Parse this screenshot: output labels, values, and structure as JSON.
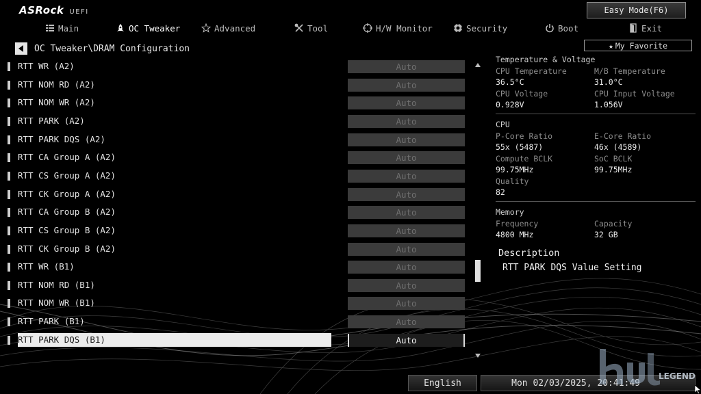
{
  "brand": {
    "logo": "ASRock",
    "suffix": "UEFI"
  },
  "easy_mode": {
    "label": "Easy Mode(F6)"
  },
  "nav": [
    {
      "id": "main",
      "label": "Main",
      "icon": "list-icon",
      "active": false
    },
    {
      "id": "oc-tweaker",
      "label": "OC Tweaker",
      "icon": "rocket-icon",
      "active": true
    },
    {
      "id": "advanced",
      "label": "Advanced",
      "icon": "star-icon",
      "active": false
    },
    {
      "id": "tool",
      "label": "Tool",
      "icon": "tools-icon",
      "active": false
    },
    {
      "id": "hw-monitor",
      "label": "H/W Monitor",
      "icon": "crosshair-icon",
      "active": false
    },
    {
      "id": "security",
      "label": "Security",
      "icon": "shield-icon",
      "active": false
    },
    {
      "id": "boot",
      "label": "Boot",
      "icon": "power-icon",
      "active": false
    },
    {
      "id": "exit",
      "label": "Exit",
      "icon": "exit-door-icon",
      "active": false
    }
  ],
  "breadcrumb": {
    "path": "OC Tweaker\\DRAM Configuration"
  },
  "favorite": {
    "label": "My Favorite"
  },
  "settings": [
    {
      "label": "RTT WR (A2)",
      "value": "Auto",
      "selected": false
    },
    {
      "label": "RTT NOM RD (A2)",
      "value": "Auto",
      "selected": false
    },
    {
      "label": "RTT NOM WR (A2)",
      "value": "Auto",
      "selected": false
    },
    {
      "label": "RTT PARK (A2)",
      "value": "Auto",
      "selected": false
    },
    {
      "label": "RTT PARK DQS (A2)",
      "value": "Auto",
      "selected": false
    },
    {
      "label": "RTT CA Group A (A2)",
      "value": "Auto",
      "selected": false
    },
    {
      "label": "RTT CS Group A (A2)",
      "value": "Auto",
      "selected": false
    },
    {
      "label": "RTT CK Group A (A2)",
      "value": "Auto",
      "selected": false
    },
    {
      "label": "RTT CA Group B (A2)",
      "value": "Auto",
      "selected": false
    },
    {
      "label": "RTT CS Group B (A2)",
      "value": "Auto",
      "selected": false
    },
    {
      "label": "RTT CK Group B (A2)",
      "value": "Auto",
      "selected": false
    },
    {
      "label": "RTT WR (B1)",
      "value": "Auto",
      "selected": false
    },
    {
      "label": "RTT NOM RD (B1)",
      "value": "Auto",
      "selected": false
    },
    {
      "label": "RTT NOM WR (B1)",
      "value": "Auto",
      "selected": false
    },
    {
      "label": "RTT PARK (B1)",
      "value": "Auto",
      "selected": false
    },
    {
      "label": "RTT PARK DQS (B1)",
      "value": "Auto",
      "selected": true
    }
  ],
  "panel": {
    "temp_voltage": {
      "title": "Temperature & Voltage",
      "items": [
        {
          "key": "CPU Temperature",
          "value": "36.5°C"
        },
        {
          "key": "M/B Temperature",
          "value": "31.0°C"
        },
        {
          "key": "CPU Voltage",
          "value": "0.928V"
        },
        {
          "key": "CPU Input Voltage",
          "value": "1.056V"
        }
      ]
    },
    "cpu": {
      "title": "CPU",
      "items": [
        {
          "key": "P-Core Ratio",
          "value": "55x (5487)"
        },
        {
          "key": "E-Core Ratio",
          "value": "46x (4589)"
        },
        {
          "key": "Compute BCLK",
          "value": "99.75MHz"
        },
        {
          "key": "SoC BCLK",
          "value": "99.75MHz"
        },
        {
          "key": "Quality",
          "value": "82"
        }
      ]
    },
    "memory": {
      "title": "Memory",
      "items": [
        {
          "key": "Frequency",
          "value": "4800 MHz"
        },
        {
          "key": "Capacity",
          "value": "32 GB"
        }
      ]
    },
    "description": {
      "title": "Description",
      "text": "RTT PARK DQS Value Setting"
    }
  },
  "footer": {
    "language": "English",
    "datetime": "Mon 02/03/2025, 20:41:49"
  },
  "watermark": {
    "text": "LEGEND"
  },
  "colors": {
    "background": "#000000",
    "selected_row": "#ececec",
    "value_box": "#3b3b3b"
  }
}
